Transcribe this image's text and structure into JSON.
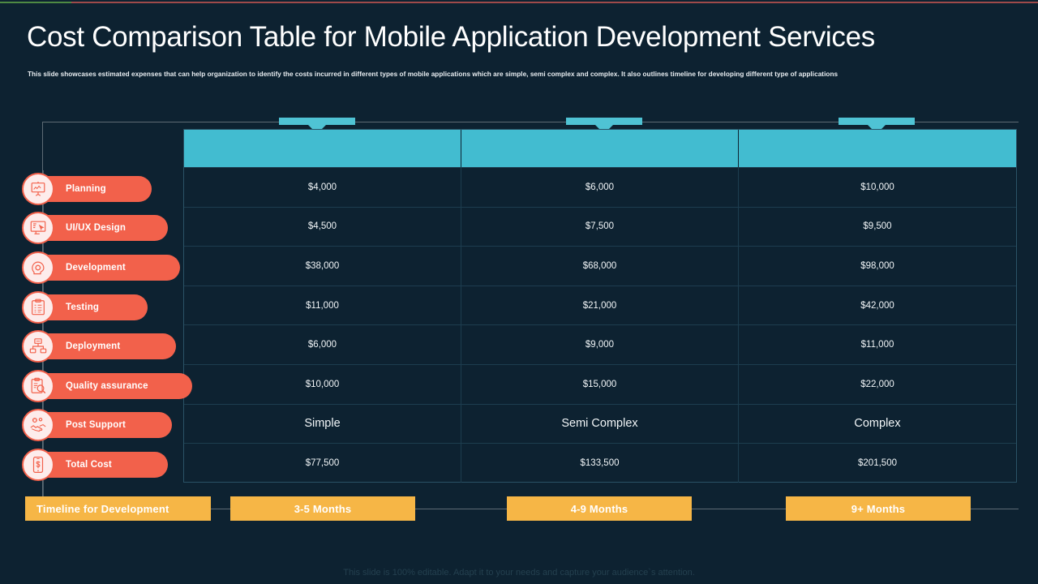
{
  "theme": {
    "background": "#0d2231",
    "accent_teal": "#42bcd0",
    "accent_coral": "#f2614b",
    "accent_amber": "#f6b646",
    "text_primary": "#ffffff",
    "rule_green": "#4e8a43",
    "rule_red": "#9e4a4a"
  },
  "header": {
    "title": "Cost Comparison Table for Mobile Application Development Services",
    "subtitle": "This slide showcases estimated expenses that can help organization  to identify the costs incurred in different types of mobile applications which are simple, semi complex and complex. It also outlines timeline for developing different type of applications"
  },
  "sidebar": {
    "items": [
      {
        "label": "Planning",
        "icon": "presentation-board-icon"
      },
      {
        "label": "UI/UX Design",
        "icon": "monitor-cursor-icon"
      },
      {
        "label": "Development",
        "icon": "head-gear-icon"
      },
      {
        "label": "Testing",
        "icon": "checklist-clipboard-icon"
      },
      {
        "label": "Deployment",
        "icon": "server-network-icon"
      },
      {
        "label": "Quality assurance",
        "icon": "clipboard-magnifier-icon"
      },
      {
        "label": "Post Support",
        "icon": "handshake-gear-icon"
      },
      {
        "label": "Total Cost",
        "icon": "mobile-dollar-icon"
      }
    ]
  },
  "table": {
    "columns": [
      "",
      "",
      ""
    ],
    "rows": [
      {
        "values": [
          "$4,000",
          "$6,000",
          "$10,000"
        ],
        "type": "cost"
      },
      {
        "values": [
          "$4,500",
          "$7,500",
          "$9,500"
        ],
        "type": "cost"
      },
      {
        "values": [
          "$38,000",
          "$68,000",
          "$98,000"
        ],
        "type": "cost"
      },
      {
        "values": [
          "$11,000",
          "$21,000",
          "$42,000"
        ],
        "type": "cost"
      },
      {
        "values": [
          "$6,000",
          "$9,000",
          "$11,000"
        ],
        "type": "cost"
      },
      {
        "values": [
          "$10,000",
          "$15,000",
          "$22,000"
        ],
        "type": "cost"
      },
      {
        "values": [
          "Simple",
          "Semi Complex",
          "Complex"
        ],
        "type": "label"
      },
      {
        "values": [
          "$77,500",
          "$133,500",
          "$201,500"
        ],
        "type": "cost"
      }
    ]
  },
  "timeline": {
    "heading": "Timeline for Development",
    "bars": [
      {
        "label": "3-5 Months"
      },
      {
        "label": "4-9 Months"
      },
      {
        "label": "9+ Months"
      }
    ]
  },
  "footer": {
    "note": "This slide is 100% editable. Adapt it to your needs and capture your audience`s attention."
  }
}
